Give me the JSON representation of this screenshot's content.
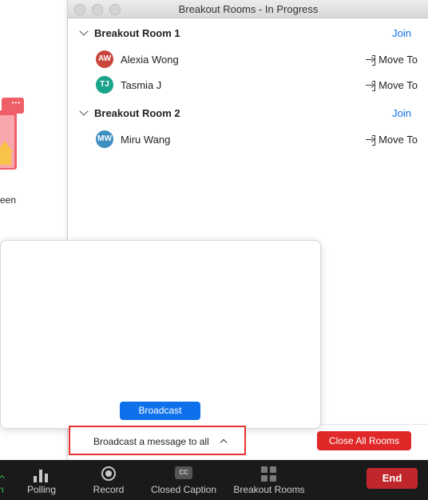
{
  "background": {
    "share_label": "een",
    "share_dots": "•••"
  },
  "window": {
    "title": "Breakout Rooms - In Progress"
  },
  "rooms": [
    {
      "name": "Breakout Room 1",
      "join_label": "Join",
      "participants": [
        {
          "initials": "AW",
          "name": "Alexia Wong",
          "color": "#c8473d",
          "action": "Move To"
        },
        {
          "initials": "TJ",
          "name": "Tasmia J",
          "color": "#1aa48c",
          "action": "Move To"
        }
      ]
    },
    {
      "name": "Breakout Room 2",
      "join_label": "Join",
      "participants": [
        {
          "initials": "MW",
          "name": "Miru Wang",
          "color": "#3e8ec2",
          "action": "Move To"
        }
      ]
    }
  ],
  "broadcast_popup": {
    "message_value": "",
    "button_label": "Broadcast"
  },
  "footer": {
    "broadcast_toggle_label": "Broadcast a message to all",
    "close_all_label": "Close All Rooms"
  },
  "toolbar": {
    "partial_label": "n",
    "polling_label": "Polling",
    "record_label": "Record",
    "cc_badge": "CC",
    "closed_caption_label": "Closed Caption",
    "breakout_label": "Breakout Rooms",
    "end_label": "End"
  },
  "colors": {
    "accent_blue": "#0e71eb",
    "close_red": "#e02828",
    "end_red": "#c0272d",
    "highlight_red": "#e8332e"
  }
}
